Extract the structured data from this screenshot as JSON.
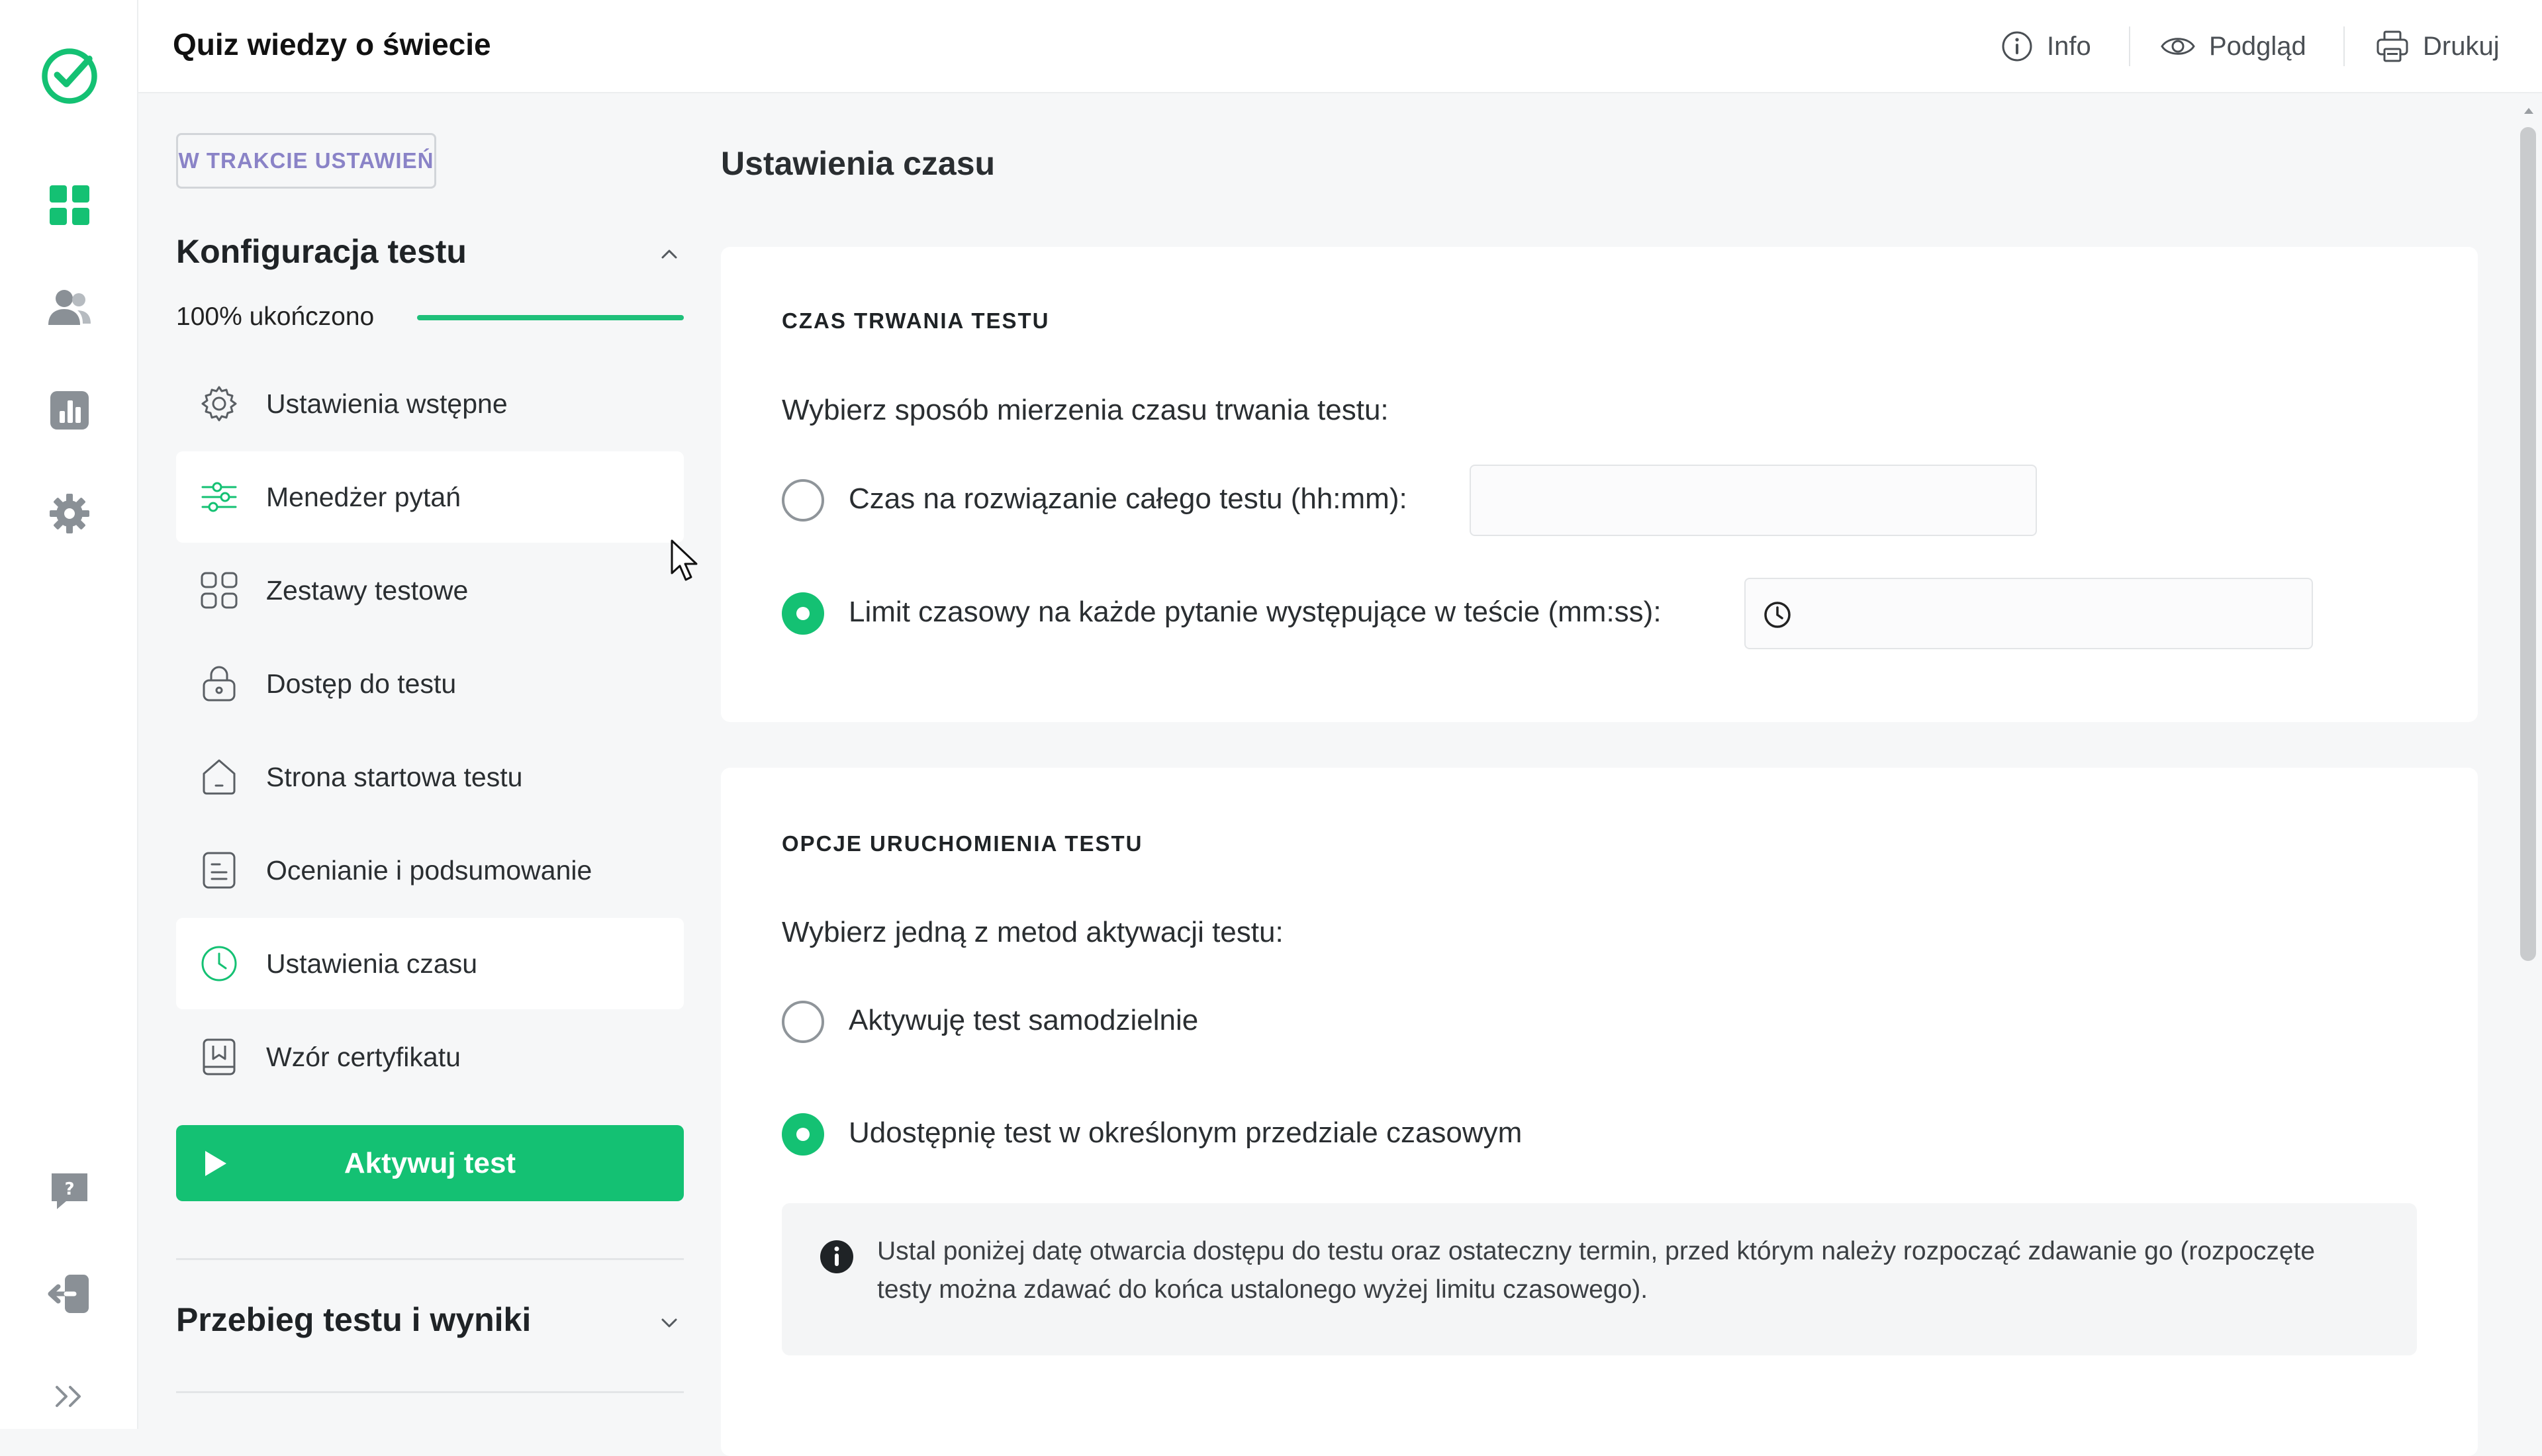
{
  "app": {
    "title": "Quiz wiedzy o świecie",
    "brand_color": "#14c173"
  },
  "rail": {
    "icons": [
      "check-logo-icon",
      "dashboard-grid-icon",
      "users-icon",
      "reports-chart-icon",
      "settings-gear-icon",
      "help-question-icon",
      "logout-icon",
      "expand-chevrons-icon"
    ]
  },
  "toolbar": {
    "info_label": "Info",
    "preview_label": "Podgląd",
    "print_label": "Drukuj"
  },
  "sidebar": {
    "status_badge": "W TRAKCIE USTAWIEŃ",
    "config_title": "Konfiguracja testu",
    "progress_label": "100% ukończono",
    "progress_value": 1.0,
    "items": [
      {
        "label": "Ustawienia wstępne",
        "icon": "gear-icon"
      },
      {
        "label": "Menedżer pytań",
        "icon": "sliders-icon"
      },
      {
        "label": "Zestawy testowe",
        "icon": "tiles-icon"
      },
      {
        "label": "Dostęp do testu",
        "icon": "lock-icon"
      },
      {
        "label": "Strona startowa testu",
        "icon": "home-icon"
      },
      {
        "label": "Ocenianie i podsumowanie",
        "icon": "document-icon"
      },
      {
        "label": "Ustawienia czasu",
        "icon": "clock-icon"
      },
      {
        "label": "Wzór certyfikatu",
        "icon": "certificate-icon"
      }
    ],
    "activate_label": "Aktywuj test",
    "results_title": "Przebieg testu i wyniki"
  },
  "main": {
    "page_title": "Ustawienia czasu",
    "duration": {
      "section_label": "CZAS TRWANIA TESTU",
      "question": "Wybierz sposób mierzenia czasu trwania testu:",
      "option_total": "Czas na rozwiązanie całego testu (hh:mm):",
      "option_total_selected": false,
      "option_total_value": "",
      "option_per_question": "Limit czasowy na każde pytanie występujące w teście (mm:ss):",
      "option_per_question_selected": true,
      "option_per_question_value": ""
    },
    "launch": {
      "section_label": "OPCJE URUCHOMIENIA TESTU",
      "question": "Wybierz jedną z metod aktywacji testu:",
      "option_manual": "Aktywuję test samodzielnie",
      "option_manual_selected": false,
      "option_window": "Udostępnię test w określonym przedziale czasowym",
      "option_window_selected": true,
      "info_text": "Ustal poniżej datę otwarcia dostępu do testu oraz ostateczny termin, przed którym należy rozpocząć zdawanie go (rozpoczęte testy można zdawać do końca ustalonego wyżej limitu czasowego)."
    }
  }
}
